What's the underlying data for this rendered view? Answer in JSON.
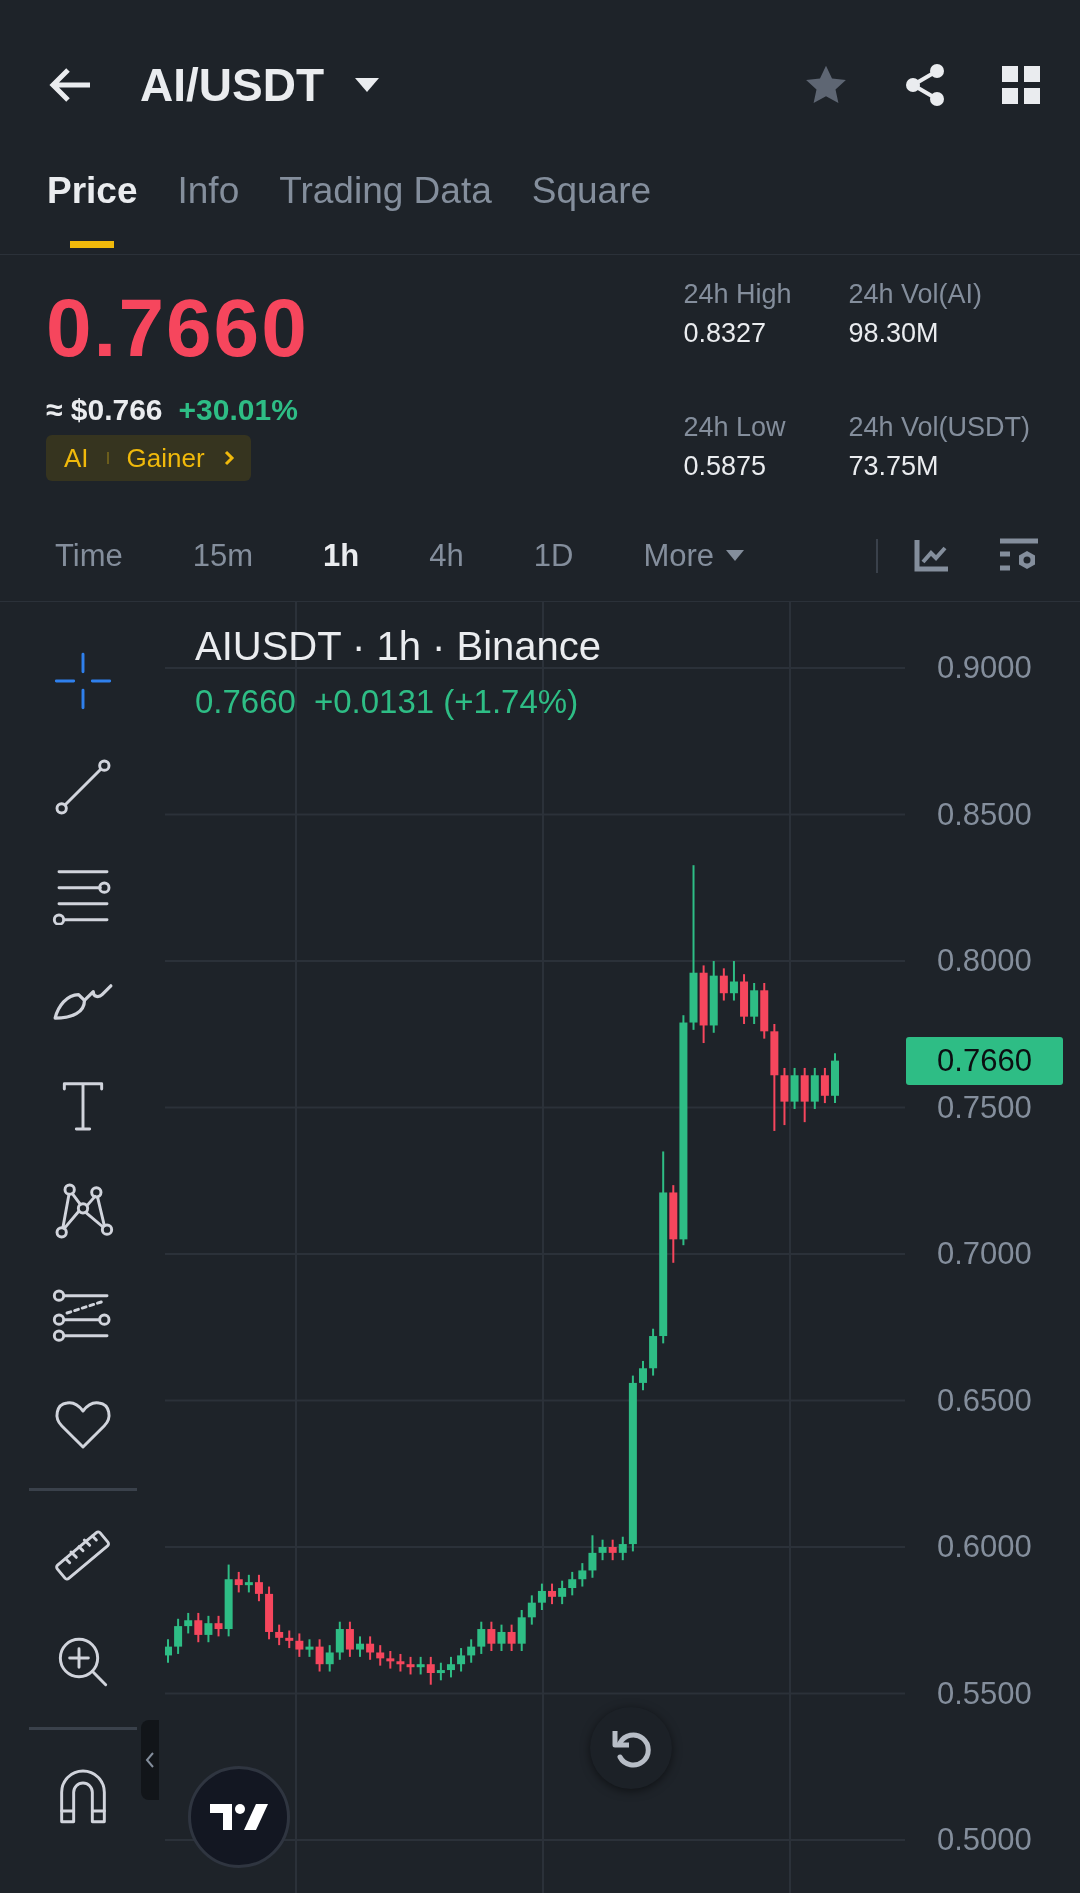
{
  "header": {
    "title": "AI/USDT",
    "favorite": false
  },
  "tabs": [
    {
      "label": "Price",
      "selected": true
    },
    {
      "label": "Info",
      "selected": false
    },
    {
      "label": "Trading Data",
      "selected": false
    },
    {
      "label": "Square",
      "selected": false
    }
  ],
  "price": {
    "last": "0.7660",
    "fiat": "≈ $0.766",
    "change": "+30.01%",
    "tags": [
      "AI",
      "Gainer"
    ]
  },
  "stats": [
    {
      "label": "24h High",
      "value": "0.8327"
    },
    {
      "label": "24h Vol(AI)",
      "value": "98.30M"
    },
    {
      "label": "24h Low",
      "value": "0.5875"
    },
    {
      "label": "24h Vol(USDT)",
      "value": "73.75M"
    }
  ],
  "intervals": [
    {
      "label": "Time",
      "selected": false,
      "kind": "plain"
    },
    {
      "label": "15m",
      "selected": false,
      "kind": "plain"
    },
    {
      "label": "1h",
      "selected": true,
      "kind": "plain"
    },
    {
      "label": "4h",
      "selected": false,
      "kind": "plain"
    },
    {
      "label": "1D",
      "selected": false,
      "kind": "plain"
    },
    {
      "label": "More",
      "selected": false,
      "kind": "dropdown"
    }
  ],
  "drawing_tools": [
    {
      "kind": "crosshair",
      "selected": true
    },
    {
      "kind": "trendline",
      "selected": false
    },
    {
      "kind": "fib",
      "selected": false
    },
    {
      "kind": "brush",
      "selected": false
    },
    {
      "kind": "text",
      "selected": false
    },
    {
      "kind": "pattern",
      "selected": false
    },
    {
      "kind": "prediction",
      "selected": false
    },
    {
      "kind": "favorites",
      "selected": false
    },
    {
      "kind": "divider"
    },
    {
      "kind": "ruler",
      "selected": false
    },
    {
      "kind": "zoom",
      "selected": false
    },
    {
      "kind": "divider"
    },
    {
      "kind": "magnet",
      "selected": false
    }
  ],
  "chart": {
    "legend_title": "AIUSDT · 1h · Binance",
    "legend_price": "0.7660",
    "legend_change": "+0.0131 (+1.74%)",
    "y_labels": [
      "0.9000",
      "0.8500",
      "0.8000",
      "0.7500",
      "0.7000",
      "0.6500",
      "0.6000",
      "0.5500",
      "0.5000"
    ],
    "last_price_tag": "0.7660"
  }
}
